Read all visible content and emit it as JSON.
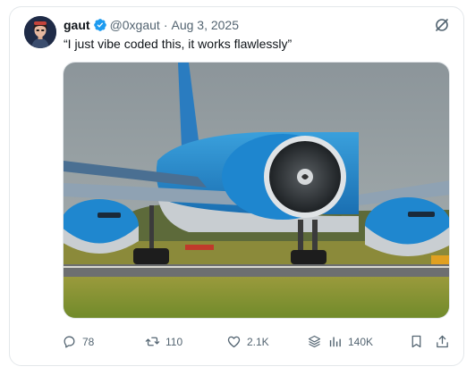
{
  "post": {
    "author_name": "gaut",
    "handle": "@0xgaut",
    "separator": "·",
    "date": "Aug 3, 2025",
    "text": "“I just vibe coded this, it works flawlessly”"
  },
  "actions": {
    "replies": "78",
    "reposts": "110",
    "likes": "2.1K",
    "views": "140K"
  },
  "colors": {
    "verified": "#1d9bf0",
    "muted_text": "#536471",
    "klm_blue": "#1f87cf"
  },
  "icons": [
    "verified-badge-icon",
    "grok-icon",
    "reply-icon",
    "repost-icon",
    "like-icon",
    "layers-icon",
    "views-icon",
    "bookmark-icon",
    "share-icon"
  ]
}
